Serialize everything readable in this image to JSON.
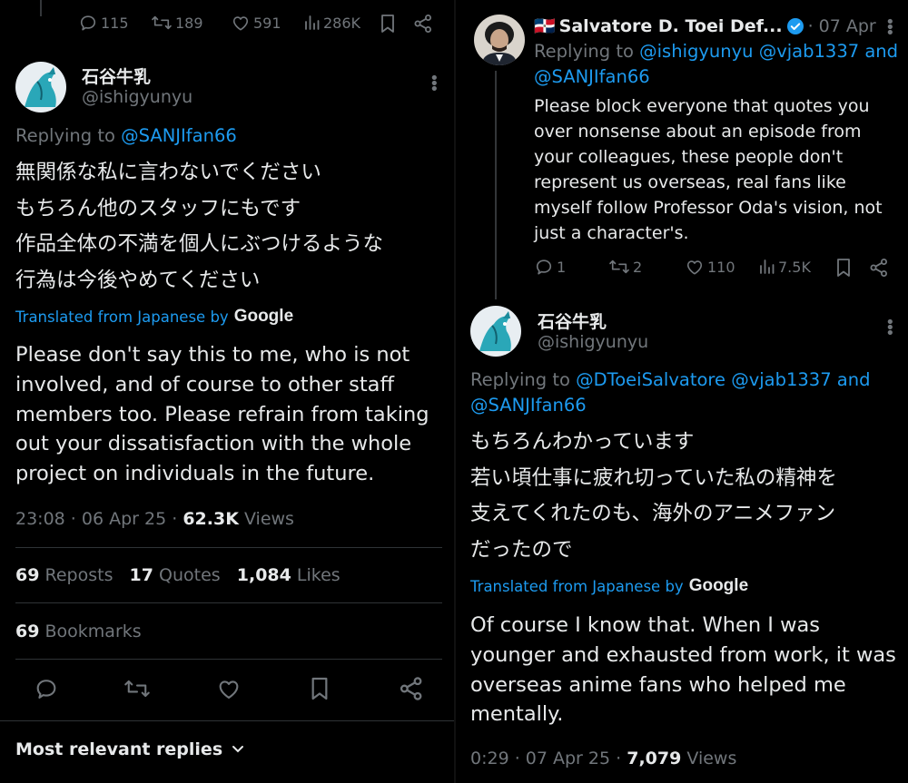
{
  "left": {
    "top_stats": {
      "replies": "115",
      "reposts": "189",
      "likes": "591",
      "views": "286K"
    },
    "tweet": {
      "author_name": "石谷牛乳",
      "author_handle": "@ishigyunyu",
      "replying_prefix": "Replying to",
      "replying_to": "@SANJIfan66",
      "jp_lines": [
        "無関係な私に言わないでください",
        "もちろん他のスタッフにもです",
        "作品全体の不満を個人にぶつけるような",
        "行為は今後やめてください"
      ],
      "translated_label": "Translated from Japanese by",
      "google_label": "Google",
      "translation": "Please don't say this to me, who is not involved, and of course to other staff members too. Please refrain from taking out your dissatisfaction with the whole project on individuals in the future.",
      "time": "23:08 · 06 Apr 25 ·",
      "views_count": "62.3K",
      "views_label": "Views",
      "reposts_count": "69",
      "reposts_label": "Reposts",
      "quotes_count": "17",
      "quotes_label": "Quotes",
      "likes_count": "1,084",
      "likes_label": "Likes",
      "bookmarks_count": "69",
      "bookmarks_label": "Bookmarks"
    },
    "replies_sort": "Most relevant replies"
  },
  "right": {
    "reply": {
      "flag": "🇩🇴",
      "author_name": "Salvatore D. Toei Def...",
      "date": "· 07 Apr",
      "replying_prefix": "Replying to",
      "replying_to_1": "@ishigyunyu @vjab1337 and",
      "replying_to_2": "@SANJIfan66",
      "text": "Please block everyone that quotes you over nonsense about an episode from your colleagues, these people don't represent us overseas, real fans like myself follow Professor Oda's vision, not just a character's.",
      "stats": {
        "replies": "1",
        "reposts": "2",
        "likes": "110",
        "views": "7.5K"
      }
    },
    "tweet": {
      "author_name": "石谷牛乳",
      "author_handle": "@ishigyunyu",
      "replying_prefix": "Replying to",
      "replying_to_1": "@DToeiSalvatore @vjab1337 and",
      "replying_to_2": "@SANJIfan66",
      "jp_lines": [
        "もちろんわかっています",
        "若い頃仕事に疲れ切っていた私の精神を",
        "支えてくれたのも、海外のアニメファン",
        "だったので"
      ],
      "translated_label": "Translated from Japanese by",
      "google_label": "Google",
      "translation": "Of course I know that. When I was younger and exhausted from work, it was overseas anime fans who helped me mentally.",
      "time": "0:29 · 07 Apr 25 ·",
      "views_count": "7,079",
      "views_label": "Views"
    }
  },
  "colors": {
    "background": "#000000",
    "text": "#e7e9ea",
    "muted": "#71767b",
    "link": "#1d9bf0",
    "verified": "#1d9bf0",
    "divider": "#2f3336"
  },
  "icons": [
    "reply-icon",
    "repost-icon",
    "like-icon",
    "views-icon",
    "bookmark-icon",
    "share-icon",
    "more-icon",
    "verified-icon",
    "chevron-down-icon"
  ]
}
